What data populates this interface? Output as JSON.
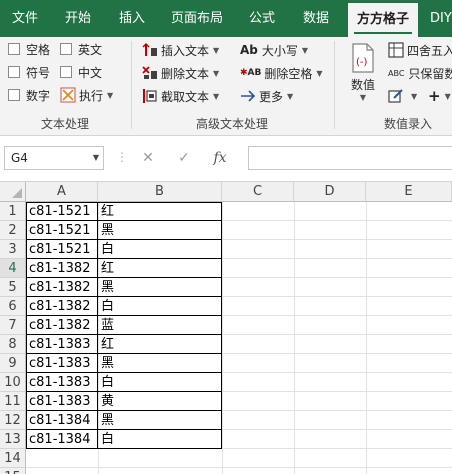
{
  "tabs": [
    "文件",
    "开始",
    "插入",
    "页面布局",
    "公式",
    "数据",
    "方方格子",
    "DIY"
  ],
  "active_tab": "方方格子",
  "ribbon": {
    "text_group": {
      "label": "文本处理",
      "checkboxes": [
        "空格",
        "英文",
        "符号",
        "中文",
        "数字"
      ],
      "execute_label": "执行"
    },
    "advanced_group": {
      "label": "高级文本处理",
      "insert_text": "插入文本",
      "delete_text": "删除文本",
      "extract_text": "截取文本",
      "case_label": "大小写",
      "case_icon_text": "Ab",
      "delete_space": "删除空格",
      "delete_space_icon_text": "AB",
      "more": "更多"
    },
    "number_group": {
      "label": "数值录入",
      "value_label": "数值",
      "round_label": "四舍五入",
      "keep_label": "只保留数",
      "keep_icon_text": "ABC"
    }
  },
  "formula_bar": {
    "name_box": "G4",
    "cancel_icon": "✕",
    "enter_icon": "✓",
    "fx_icon": "fx",
    "formula": ""
  },
  "columns": [
    "A",
    "B",
    "C",
    "D",
    "E"
  ],
  "rows": [
    "1",
    "2",
    "3",
    "4",
    "5",
    "6",
    "7",
    "8",
    "9",
    "10",
    "11",
    "12",
    "13",
    "14",
    "15"
  ],
  "selected_row": "4",
  "table": [
    [
      "c81-1521",
      "红"
    ],
    [
      "c81-1521",
      "黑"
    ],
    [
      "c81-1521",
      "白"
    ],
    [
      "c81-1382",
      "红"
    ],
    [
      "c81-1382",
      "黑"
    ],
    [
      "c81-1382",
      "白"
    ],
    [
      "c81-1382",
      "蓝"
    ],
    [
      "c81-1383",
      "红"
    ],
    [
      "c81-1383",
      "黑"
    ],
    [
      "c81-1383",
      "白"
    ],
    [
      "c81-1383",
      "黄"
    ],
    [
      "c81-1384",
      "黑"
    ],
    [
      "c81-1384",
      "白"
    ]
  ],
  "colors": {
    "excel_green": "#217346",
    "ribbon_bg": "#f3f3f3",
    "accent_red": "#c00000",
    "accent_blue": "#2b579a"
  }
}
